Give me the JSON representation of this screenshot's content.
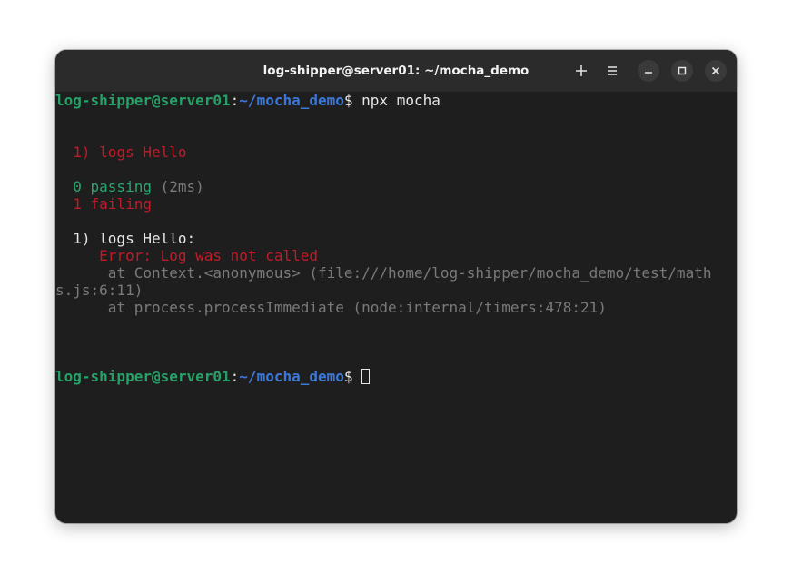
{
  "window": {
    "title": "log-shipper@server01: ~/mocha_demo",
    "buttons": [
      "new-tab-icon",
      "menu-icon",
      "minimize-icon",
      "maximize-icon",
      "close-icon"
    ]
  },
  "terminal": {
    "prompt_user": "log-shipper@server01",
    "prompt_sep": ":",
    "prompt_path": "~/mocha_demo",
    "prompt_symbol": "$",
    "command": " npx mocha",
    "fail_item": "  1) logs Hello",
    "passing_label": "  0 passing",
    "passing_time": " (2ms)",
    "failing_label": "  1 failing",
    "detail_header": "  1) logs Hello:",
    "error_message": "     Error: Log was not called",
    "stack_line_1a": "      at Context.<anonymous> (file:///home/log-shipper/mocha_demo/test/math",
    "stack_line_1b": "s.js:6:11)",
    "stack_line_2": "      at process.processImmediate (node:internal/timers:478:21)",
    "prompt_symbol_2": "$ "
  },
  "colors": {
    "background": "#1e1e1e",
    "prompt_user": "#26a269",
    "prompt_path": "#3c78d8",
    "error": "#c01c28",
    "passing": "#2aa56f",
    "muted": "#7a7a7a"
  }
}
